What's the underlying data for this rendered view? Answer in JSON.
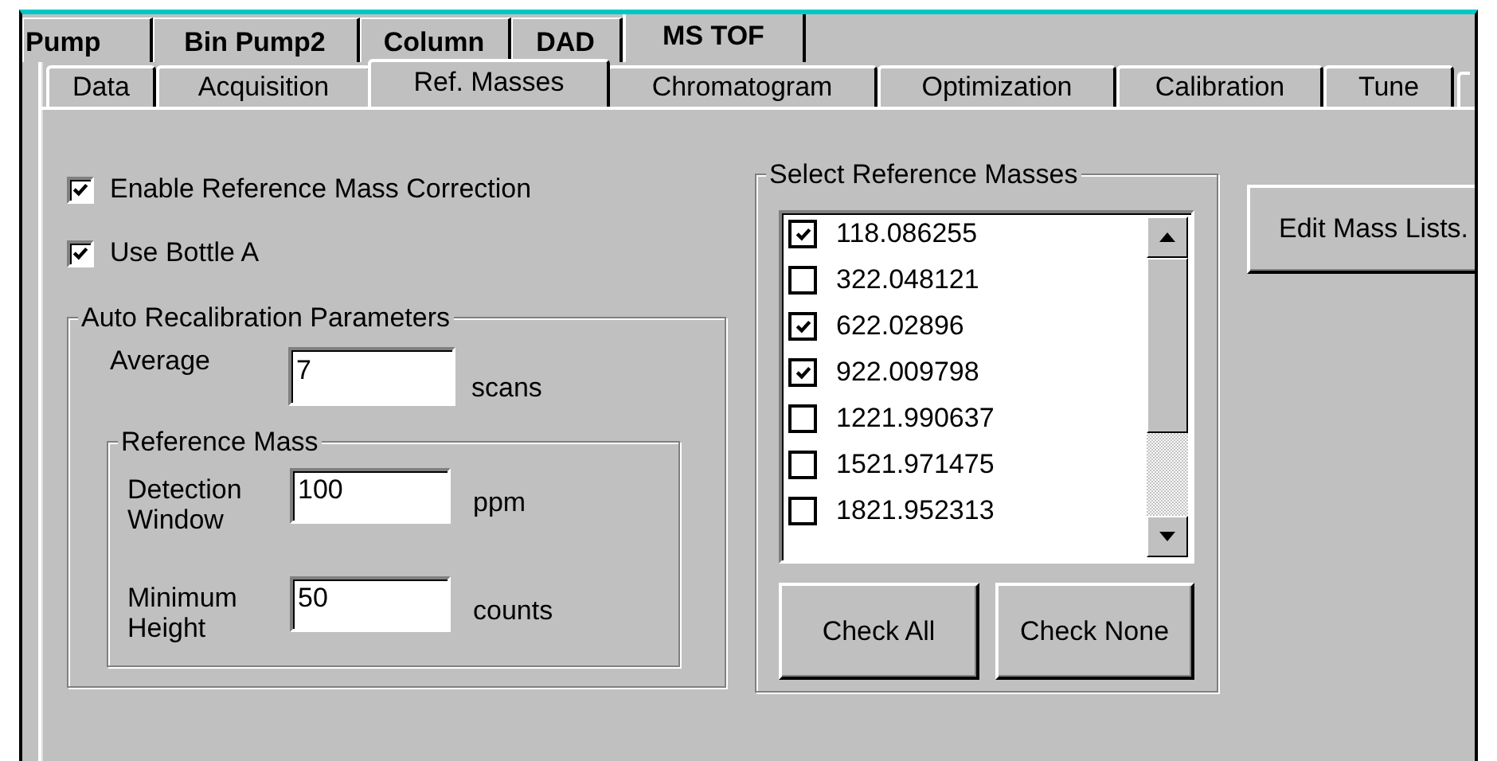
{
  "outer_tabs": [
    {
      "label": "Pump",
      "selected": false
    },
    {
      "label": "Bin Pump2",
      "selected": false
    },
    {
      "label": "Column",
      "selected": false
    },
    {
      "label": "DAD",
      "selected": false
    },
    {
      "label": "MS TOF",
      "selected": true
    }
  ],
  "inner_tabs": [
    {
      "label": "Data",
      "selected": false
    },
    {
      "label": "Acquisition",
      "selected": false
    },
    {
      "label": "Ref. Masses",
      "selected": true
    },
    {
      "label": "Chromatogram",
      "selected": false
    },
    {
      "label": "Optimization",
      "selected": false
    },
    {
      "label": "Calibration",
      "selected": false
    },
    {
      "label": "Tune",
      "selected": false
    }
  ],
  "options": [
    {
      "label": "Enable Reference Mass Correction",
      "checked": true
    },
    {
      "label": "Use Bottle A",
      "checked": true
    }
  ],
  "auto_recalibration": {
    "title": "Auto Recalibration Parameters",
    "average": {
      "label": "Average",
      "value": "7",
      "unit": "scans"
    },
    "reference_mass": {
      "title": "Reference Mass",
      "fields": [
        {
          "label": "Detection Window",
          "value": "100",
          "unit": "ppm"
        },
        {
          "label": "Minimum Height",
          "value": "50",
          "unit": "counts"
        }
      ]
    }
  },
  "reference_masses": {
    "title": "Select Reference Masses",
    "items": [
      {
        "mass": "118.086255",
        "checked": true
      },
      {
        "mass": "322.048121",
        "checked": false
      },
      {
        "mass": "622.02896",
        "checked": true
      },
      {
        "mass": "922.009798",
        "checked": true
      },
      {
        "mass": "1221.990637",
        "checked": false
      },
      {
        "mass": "1521.971475",
        "checked": false
      },
      {
        "mass": "1821.952313",
        "checked": false
      }
    ],
    "buttons": [
      "Check All",
      "Check None"
    ]
  },
  "edit_button": "Edit Mass Lists."
}
